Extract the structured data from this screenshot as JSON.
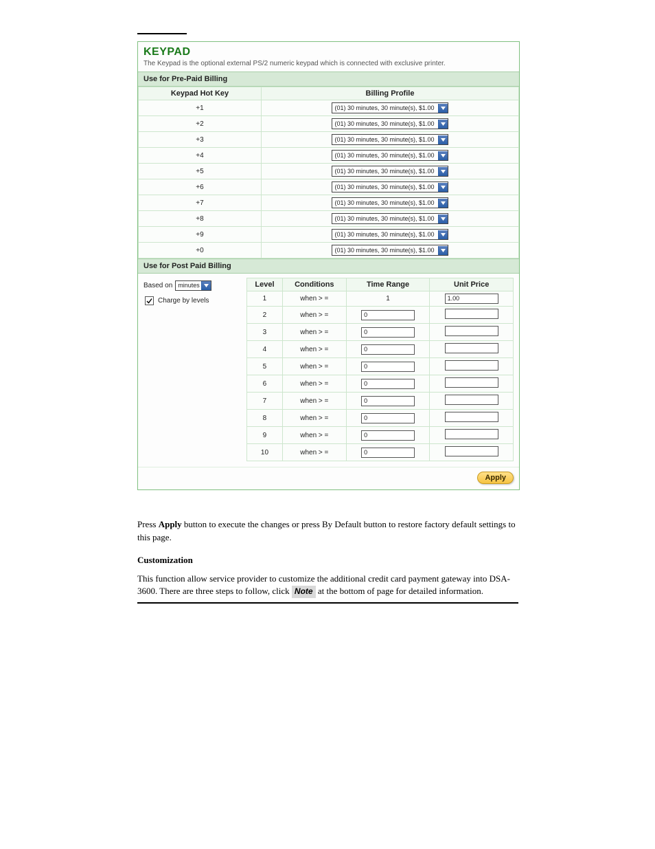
{
  "panel": {
    "title": "KEYPAD",
    "desc": "The Keypad is the optional external PS/2 numeric keypad which is connected with exclusive printer."
  },
  "prepaid": {
    "section_title": "Use for Pre-Paid Billing",
    "col_hotkey": "Keypad Hot Key",
    "col_profile": "Billing Profile",
    "profile_option": "(01) 30 minutes, 30 minute(s), $1.00",
    "rows": [
      "+1",
      "+2",
      "+3",
      "+4",
      "+5",
      "+6",
      "+7",
      "+8",
      "+9",
      "+0"
    ]
  },
  "postpaid": {
    "section_title": "Use for Post Paid Billing",
    "basedon_label": "Based on",
    "basedon_value": "minutes",
    "charge_by_levels_label": "Charge by levels",
    "charge_by_levels_checked": true,
    "col_level": "Level",
    "col_conditions": "Conditions",
    "col_timerange": "Time Range",
    "col_unitprice": "Unit Price",
    "condition_text": "when > =",
    "rows": [
      {
        "level": "1",
        "time_range": "1",
        "unit_price": "1.00",
        "time_editable": false
      },
      {
        "level": "2",
        "time_range": "0",
        "unit_price": "",
        "time_editable": true
      },
      {
        "level": "3",
        "time_range": "0",
        "unit_price": "",
        "time_editable": true
      },
      {
        "level": "4",
        "time_range": "0",
        "unit_price": "",
        "time_editable": true
      },
      {
        "level": "5",
        "time_range": "0",
        "unit_price": "",
        "time_editable": true
      },
      {
        "level": "6",
        "time_range": "0",
        "unit_price": "",
        "time_editable": true
      },
      {
        "level": "7",
        "time_range": "0",
        "unit_price": "",
        "time_editable": true
      },
      {
        "level": "8",
        "time_range": "0",
        "unit_price": "",
        "time_editable": true
      },
      {
        "level": "9",
        "time_range": "0",
        "unit_price": "",
        "time_editable": true
      },
      {
        "level": "10",
        "time_range": "0",
        "unit_price": "",
        "time_editable": true
      }
    ]
  },
  "apply_label": "Apply",
  "body": {
    "p1_prefix": "Press ",
    "p1_btn": "Apply",
    "p1_suffix": " button to execute the changes or press By Default button to restore factory default settings to this page.",
    "subhead": "Customization",
    "p2_prefix": "This function allow service provider to customize the additional credit card payment gateway into DSA-3600. There are three steps to follow, click",
    "p2_note": "Note",
    "p2_suffix": "at the bottom of page for detailed information."
  }
}
